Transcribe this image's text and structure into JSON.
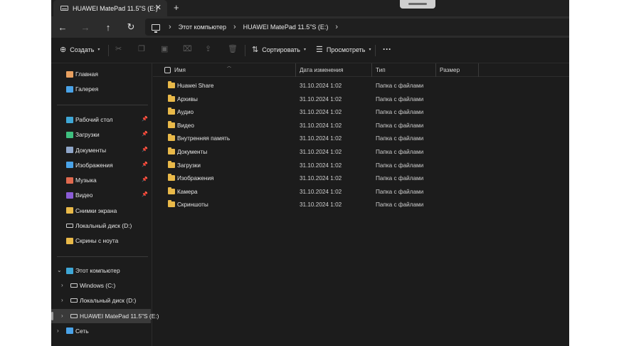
{
  "window": {
    "tab_title": "HUAWEI MatePad 11.5\"S (E:)",
    "tab_close": "✕",
    "new_tab": "+"
  },
  "address": {
    "breadcrumbs": [
      "Этот компьютер",
      "HUAWEI MatePad 11.5\"S (E:)"
    ]
  },
  "toolbar": {
    "create_label": "Создать",
    "sort_label": "Сортировать",
    "view_label": "Просмотреть",
    "more_label": "···"
  },
  "sidebar": {
    "top": [
      {
        "label": "Главная",
        "icon": "home-icon",
        "color": "#e8a060"
      },
      {
        "label": "Галерея",
        "icon": "gallery-icon",
        "color": "#4aa3e8"
      }
    ],
    "quick": [
      {
        "label": "Рабочий стол",
        "icon": "desktop-icon",
        "color": "#3fa7d6",
        "pinned": true
      },
      {
        "label": "Загрузки",
        "icon": "download-icon",
        "color": "#3fbf7f",
        "pinned": true
      },
      {
        "label": "Документы",
        "icon": "documents-icon",
        "color": "#8fa6c9",
        "pinned": true
      },
      {
        "label": "Изображения",
        "icon": "pictures-icon",
        "color": "#4aa3e8",
        "pinned": true
      },
      {
        "label": "Музыка",
        "icon": "music-icon",
        "color": "#e06a4f",
        "pinned": true
      },
      {
        "label": "Видео",
        "icon": "video-icon",
        "color": "#8b5cd6",
        "pinned": true
      },
      {
        "label": "Снимки экрана",
        "icon": "folder-icon",
        "color": "#e9b949",
        "pinned": false
      },
      {
        "label": "Локальный диск (D:)",
        "icon": "drive-icon",
        "color": "#cfcfcf",
        "pinned": false
      },
      {
        "label": "Скрины с ноута",
        "icon": "folder-icon",
        "color": "#e9b949",
        "pinned": false
      }
    ],
    "tree": [
      {
        "label": "Этот компьютер",
        "icon": "computer-icon",
        "expanded": true,
        "indent": 0
      },
      {
        "label": "Windows (C:)",
        "icon": "windows-drive-icon",
        "expanded": false,
        "indent": 1
      },
      {
        "label": "Локальный диск (D:)",
        "icon": "drive-icon",
        "expanded": false,
        "indent": 1
      },
      {
        "label": "HUAWEI MatePad 11.5\"S (E:)",
        "icon": "device-drive-icon",
        "expanded": false,
        "indent": 1,
        "selected": true
      },
      {
        "label": "Сеть",
        "icon": "network-icon",
        "expanded": false,
        "indent": 0
      }
    ]
  },
  "columns": {
    "name": "Имя",
    "date": "Дата изменения",
    "type": "Тип",
    "size": "Размер"
  },
  "files": [
    {
      "name": "Huawei Share",
      "date": "31.10.2024 1:02",
      "type": "Папка с файлами"
    },
    {
      "name": "Архивы",
      "date": "31.10.2024 1:02",
      "type": "Папка с файлами"
    },
    {
      "name": "Аудио",
      "date": "31.10.2024 1:02",
      "type": "Папка с файлами"
    },
    {
      "name": "Видео",
      "date": "31.10.2024 1:02",
      "type": "Папка с файлами"
    },
    {
      "name": "Внутренняя память",
      "date": "31.10.2024 1:02",
      "type": "Папка с файлами"
    },
    {
      "name": "Документы",
      "date": "31.10.2024 1:02",
      "type": "Папка с файлами"
    },
    {
      "name": "Загрузки",
      "date": "31.10.2024 1:02",
      "type": "Папка с файлами"
    },
    {
      "name": "Изображения",
      "date": "31.10.2024 1:02",
      "type": "Папка с файлами"
    },
    {
      "name": "Камера",
      "date": "31.10.2024 1:02",
      "type": "Папка с файлами"
    },
    {
      "name": "Скриншоты",
      "date": "31.10.2024 1:02",
      "type": "Папка с файлами"
    }
  ]
}
